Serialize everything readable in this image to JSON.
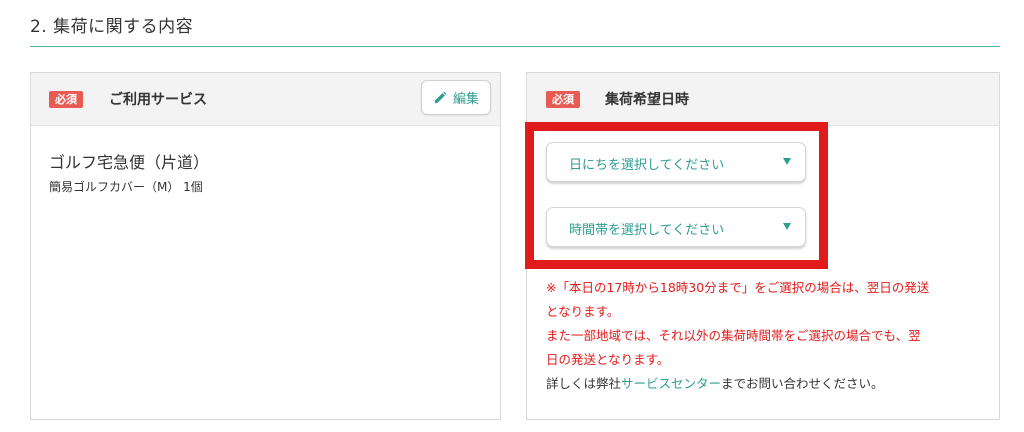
{
  "section": {
    "title": "2. 集荷に関する内容"
  },
  "service_card": {
    "required_badge": "必須",
    "heading": "ご利用サービス",
    "edit_label": "編集",
    "service_name": "ゴルフ宅急便（片道）",
    "service_detail": "簡易ゴルフカバー（M）  1個"
  },
  "pickup_card": {
    "required_badge": "必須",
    "heading": "集荷希望日時",
    "date_select": {
      "selected_text": "日にちを選択してください"
    },
    "time_select": {
      "selected_text": "時間帯を選択してください"
    },
    "notes": [
      "※「本日の17時から18時30分まで」をご選択の場合は、翌日の発送",
      "となります。",
      "また一部地域では、それ以外の集荷時間帯をご選択の場合でも、翌",
      "日の発送となります。"
    ],
    "contact": {
      "prefix": "詳しくは弊社",
      "link": "サービスセンター",
      "suffix": "までお問い合わせください。"
    }
  },
  "colors": {
    "accent": "#2e9e8f",
    "badge": "#e85b55",
    "warning": "#e11b1b",
    "highlight_border": "#e11b1b"
  },
  "icons": {
    "edit": "pencil-icon",
    "dropdown": "triangle-down-icon"
  }
}
